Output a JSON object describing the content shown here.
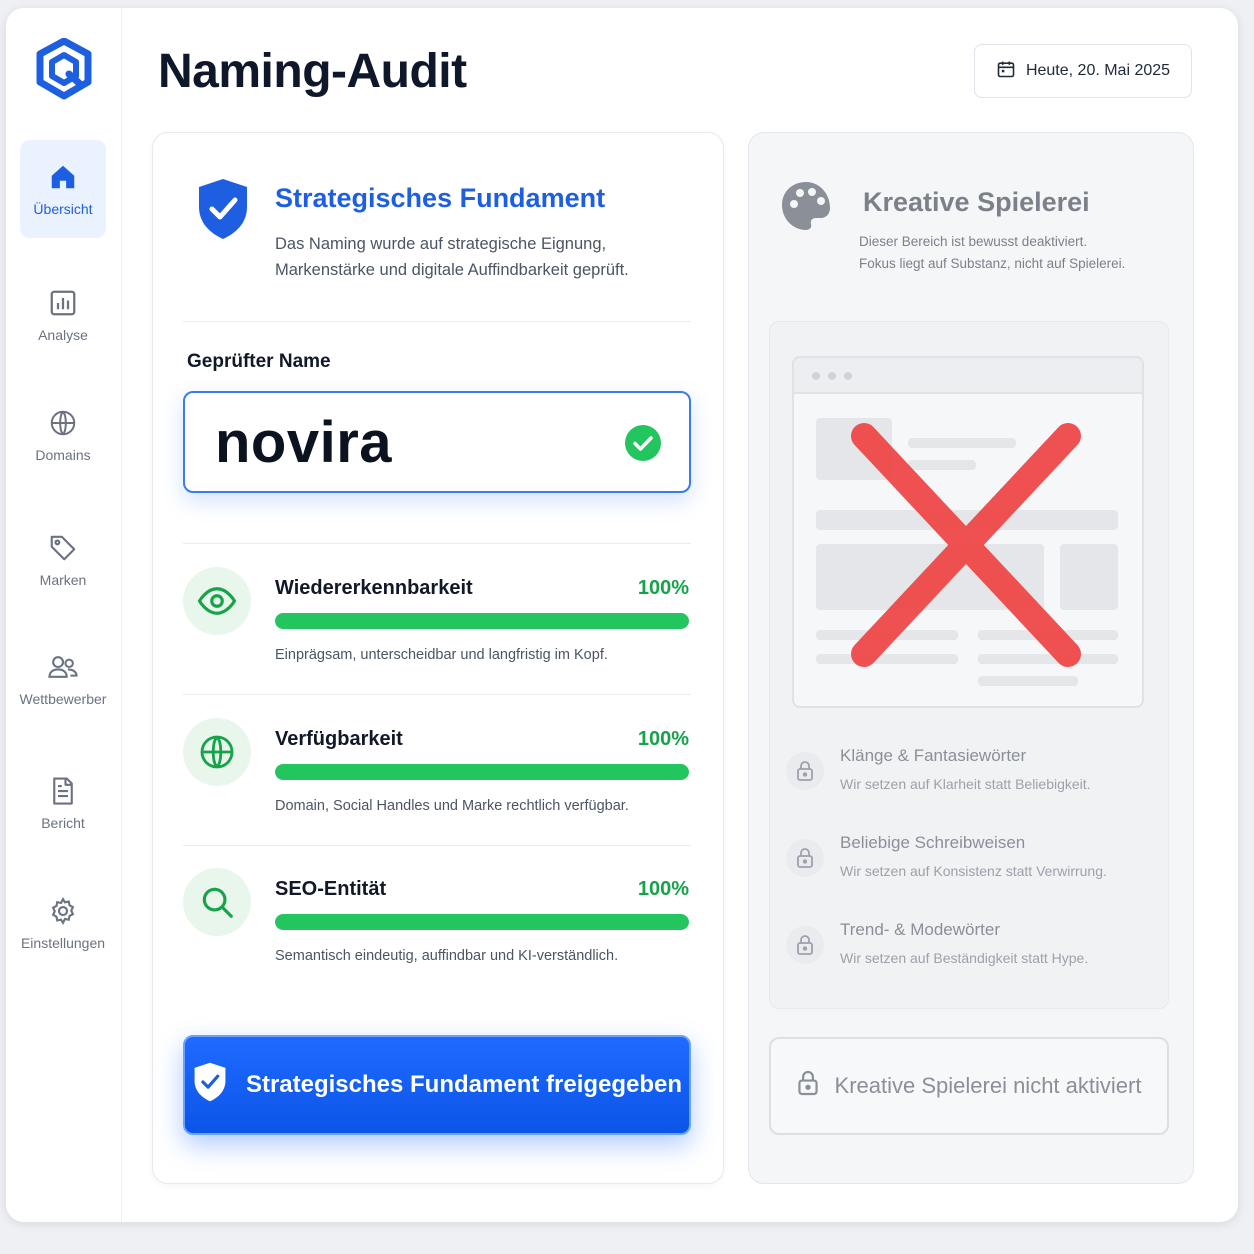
{
  "sidebar": {
    "items": [
      {
        "label": "Übersicht",
        "icon": "home-icon",
        "active": true
      },
      {
        "label": "Analyse",
        "icon": "bar-chart-icon"
      },
      {
        "label": "Domains",
        "icon": "globe-icon"
      },
      {
        "label": "Marken",
        "icon": "tag-icon"
      },
      {
        "label": "Wettbewerber",
        "icon": "users-icon"
      },
      {
        "label": "Bericht",
        "icon": "document-icon"
      },
      {
        "label": "Einstellungen",
        "icon": "gear-icon"
      }
    ]
  },
  "header": {
    "title": "Naming-Audit",
    "date": "Heute, 20. Mai 2025"
  },
  "strategic": {
    "title": "Strategisches Fundament",
    "description": "Das Naming wurde auf strategische Eignung, Markenstärke und digitale Auffindbarkeit geprüft.",
    "name_label": "Geprüfter Name",
    "name_value": "novira",
    "metrics": [
      {
        "name": "Wiedererkennbarkeit",
        "percent_label": "100%",
        "percent": 100,
        "description": "Einprägsam, unterscheidbar und langfristig im Kopf.",
        "icon": "eye-icon"
      },
      {
        "name": "Verfügbarkeit",
        "percent_label": "100%",
        "percent": 100,
        "description": "Domain, Social Handles und Marke rechtlich verfügbar.",
        "icon": "globe-icon"
      },
      {
        "name": "SEO-Entität",
        "percent_label": "100%",
        "percent": 100,
        "description": "Semantisch eindeutig, auffindbar und KI-verständlich.",
        "icon": "search-icon"
      }
    ],
    "button_label": "Strategisches Fundament freigegeben"
  },
  "creative": {
    "title": "Kreative Spielerei",
    "description_1": "Dieser Bereich ist bewusst deaktiviert.",
    "description_2": "Fokus liegt auf Substanz, nicht auf Spielerei.",
    "locked_items": [
      {
        "title": "Klänge & Fantasiewörter",
        "description": "Wir setzen auf Klarheit statt Beliebigkeit."
      },
      {
        "title": "Beliebige Schreibweisen",
        "description": "Wir setzen auf Konsistenz statt Verwirrung."
      },
      {
        "title": "Trend- & Modewörter",
        "description": "Wir setzen auf Beständigkeit statt Hype."
      }
    ],
    "button_label": "Kreative Spielerei nicht aktiviert"
  },
  "colors": {
    "accent": "#1d5fe0",
    "success": "#22c55e",
    "danger": "#ef4444",
    "muted": "#8a8f98"
  }
}
